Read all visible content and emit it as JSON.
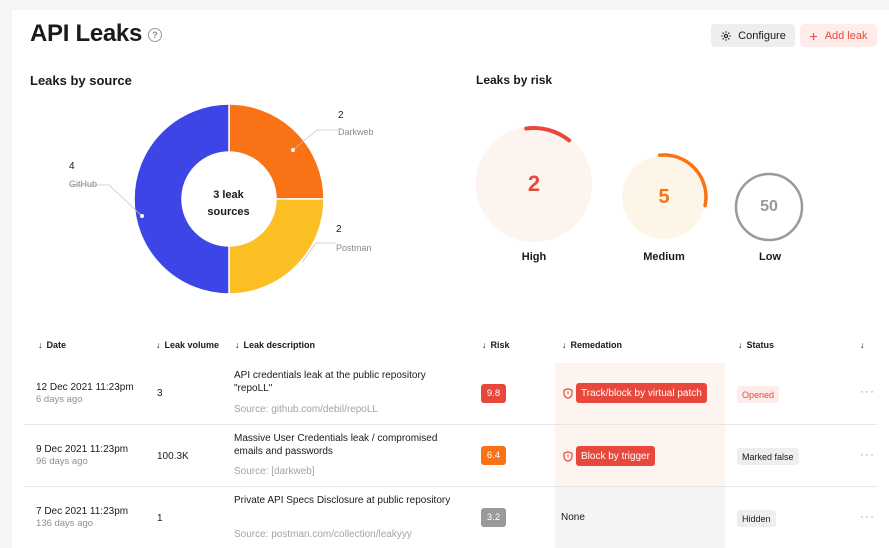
{
  "header": {
    "title": "API Leaks",
    "help_glyph": "?",
    "configure_label": "Configure",
    "add_label": "Add leak"
  },
  "colors": {
    "accent_red": "#e8473c",
    "github_blue": "#3d45e6",
    "darkweb_orange": "#f97316",
    "postman_yellow": "#fbbf24"
  },
  "sources": {
    "title": "Leaks by source",
    "center_line1": "3 leak",
    "center_line2": "sources",
    "chart_data": {
      "type": "pie",
      "donut": true,
      "categories": [
        "GitHub",
        "Darkweb",
        "Postman"
      ],
      "values": [
        4,
        2,
        2
      ],
      "colors": [
        "#3d45e6",
        "#f97316",
        "#fbbf24"
      ]
    },
    "labels": [
      {
        "count": "4",
        "name": "GitHub"
      },
      {
        "count": "2",
        "name": "Darkweb"
      },
      {
        "count": "2",
        "name": "Postman"
      }
    ]
  },
  "risk": {
    "title": "Leaks by risk",
    "levels": [
      {
        "label": "High",
        "value": "2",
        "color": "#e8473c",
        "bg": "#fdf3ef",
        "arc_fraction": 0.13
      },
      {
        "label": "Medium",
        "value": "5",
        "color": "#f97316",
        "bg": "#fdf6e8",
        "arc_fraction": 0.3
      },
      {
        "label": "Low",
        "value": "50",
        "color": "#9a9a9a",
        "bg": "#ffffff",
        "arc_fraction": 1.0
      }
    ]
  },
  "table": {
    "columns": [
      "Date",
      "Leak volume",
      "Leak description",
      "Risk",
      "Remedation",
      "Status"
    ],
    "sort_glyph": "↓",
    "more_glyph": "···",
    "rows": [
      {
        "date": "12 Dec 2021 11:23pm",
        "ago": "6 days ago",
        "volume": "3",
        "description": "API credentials leak at the public repository \"repoLL\"",
        "source": "Source: github.com/debil/repoLL",
        "risk": "9.8",
        "risk_color": "#e8473c",
        "remediation": "Track/block by virtual patch",
        "status": "Opened"
      },
      {
        "date": "9 Dec 2021 11:23pm",
        "ago": "96 days ago",
        "volume": "100.3K",
        "description": "Massive User Credentials leak / compromised emails and passwords",
        "source": "Source: [darkweb]",
        "risk": "6.4",
        "risk_color": "#f97316",
        "remediation": "Block by trigger",
        "status": "Marked false"
      },
      {
        "date": "7 Dec 2021 11:23pm",
        "ago": "136 days ago",
        "volume": "1",
        "description": "Private API Specs Disclosure at public repository",
        "source": "Source: postman.com/collection/leakyyy",
        "risk": "3.2",
        "risk_color": "#9a9a9a",
        "remediation": "None",
        "status": "Hidden"
      }
    ]
  }
}
